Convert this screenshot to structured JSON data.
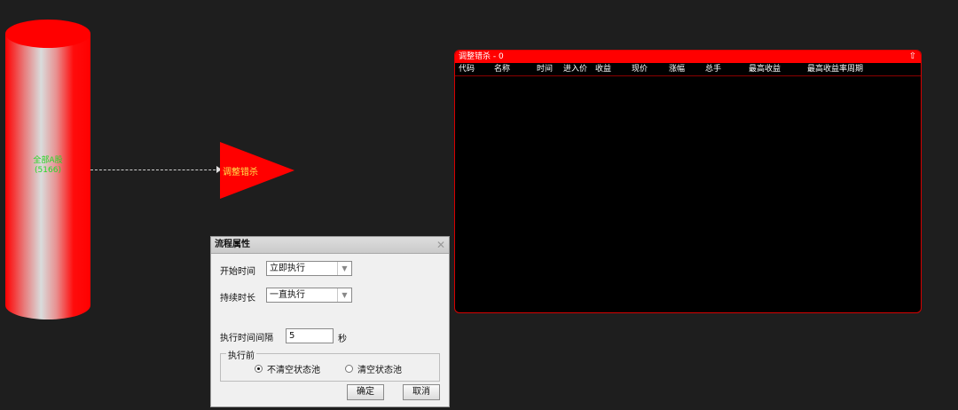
{
  "flow": {
    "source_node": {
      "label_line1": "全部A股",
      "label_line2": "(5166)"
    },
    "filter_node": {
      "label": "调整错杀"
    }
  },
  "result_panel": {
    "title": "调整错杀 - 0",
    "collapse_icon": "collapse-up-icon",
    "columns": [
      "代码",
      "名称",
      "时间",
      "进入价",
      "收益",
      "现价",
      "涨幅",
      "总手",
      "最高收益",
      "最高收益率周期"
    ],
    "rows": []
  },
  "dialog": {
    "title": "流程属性",
    "start_time": {
      "label": "开始时间",
      "value": "立即执行"
    },
    "duration": {
      "label": "持续时长",
      "value": "一直执行"
    },
    "interval": {
      "label": "执行时间间隔",
      "value": "5",
      "unit": "秒"
    },
    "before_exec": {
      "legend": "执行前",
      "option_keep": "不清空状态池",
      "option_clear": "清空状态池",
      "selected": "option_keep"
    },
    "ok_label": "确定",
    "cancel_label": "取消"
  },
  "colors": {
    "background": "#1e1e1e",
    "accent_red": "#ff0000",
    "node_label_green": "#27d827",
    "node_label_yellow": "#ffe34a"
  }
}
